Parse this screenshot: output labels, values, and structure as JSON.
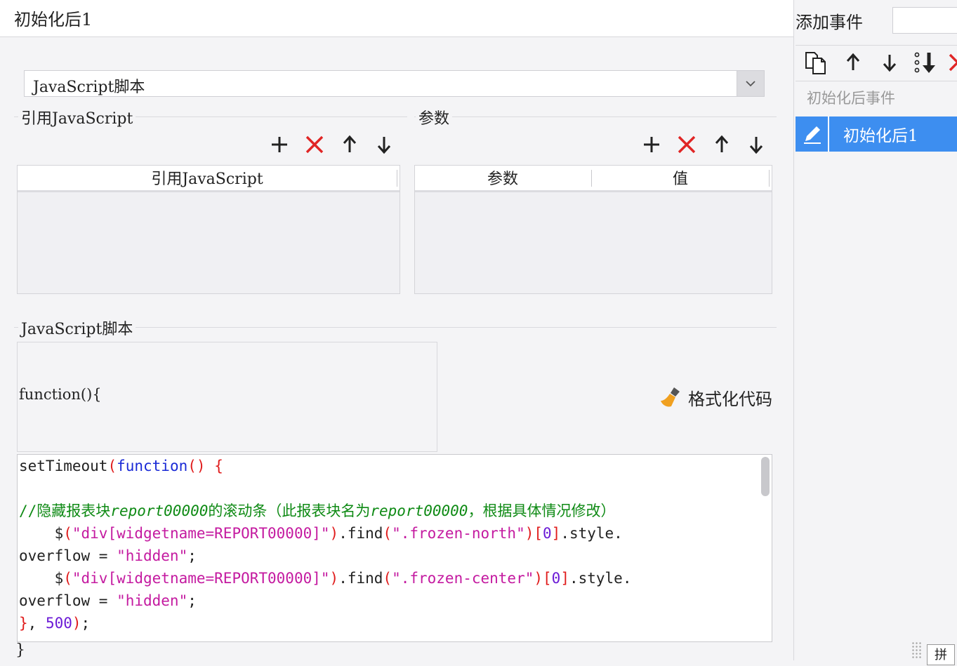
{
  "header": {
    "title": "初始化后1"
  },
  "script_type": {
    "selected": "JavaScript脚本"
  },
  "ref_section": {
    "label": "引用JavaScript",
    "column": "引用JavaScript",
    "rows": []
  },
  "param_section": {
    "label": "参数",
    "columns": [
      "参数",
      "值"
    ],
    "rows": []
  },
  "js_section": {
    "label": "JavaScript脚本",
    "function_header": "function(){",
    "format_label": "格式化代码",
    "closing": "}"
  },
  "right_panel": {
    "add_event_label": "添加事件",
    "add_event_value": "",
    "group_label": "初始化后事件",
    "selected_item": "初始化后1",
    "corner_label": "拼"
  },
  "colors": {
    "accent": "#3d8ef0",
    "delete": "#e02525",
    "keyword": "#1a2ad6",
    "string": "#c41aa0",
    "comment": "#0e8a14"
  }
}
